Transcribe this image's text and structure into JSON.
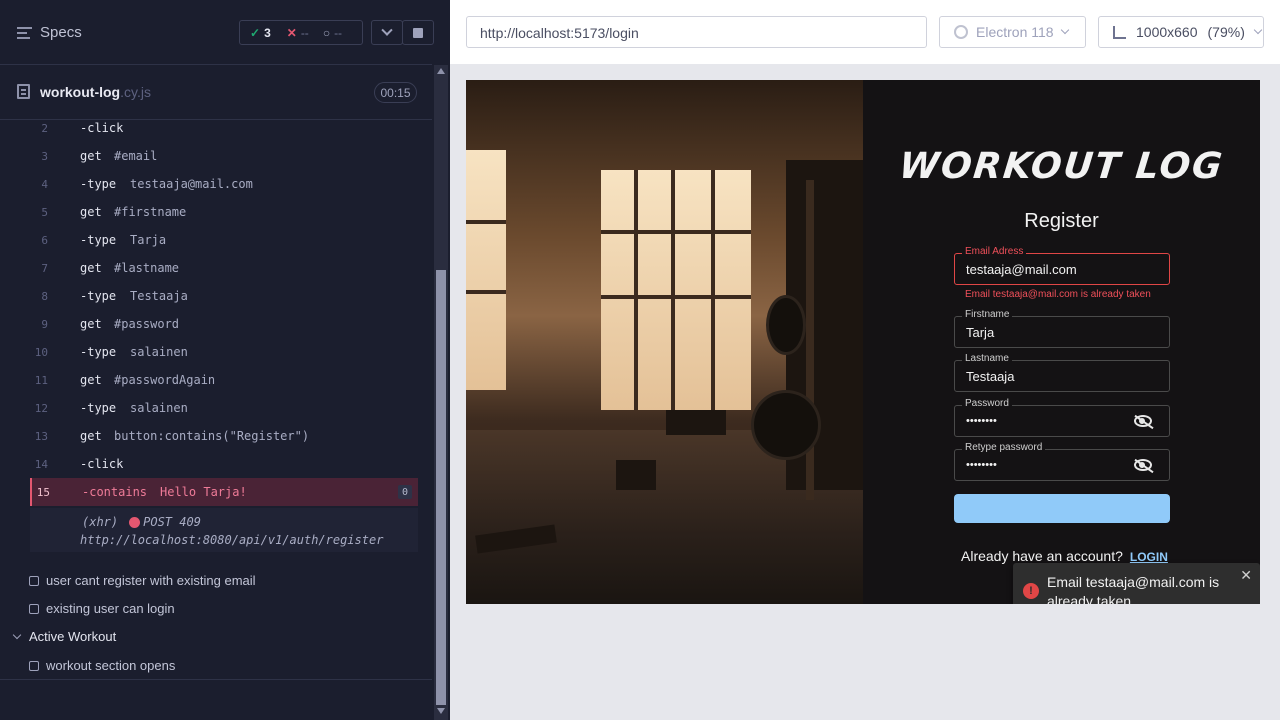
{
  "runner": {
    "specs_label": "Specs",
    "passed": "3",
    "failed": "--",
    "pending": "--",
    "file_name": "workout-log",
    "file_ext": ".cy.js",
    "duration": "00:15"
  },
  "commands": [
    {
      "num": "2",
      "name": "-click",
      "msg": ""
    },
    {
      "num": "3",
      "name": "get",
      "msg": "#email"
    },
    {
      "num": "4",
      "name": "-type",
      "msg": "testaaja@mail.com"
    },
    {
      "num": "5",
      "name": "get",
      "msg": "#firstname"
    },
    {
      "num": "6",
      "name": "-type",
      "msg": "Tarja"
    },
    {
      "num": "7",
      "name": "get",
      "msg": "#lastname"
    },
    {
      "num": "8",
      "name": "-type",
      "msg": "Testaaja"
    },
    {
      "num": "9",
      "name": "get",
      "msg": "#password"
    },
    {
      "num": "10",
      "name": "-type",
      "msg": "salainen"
    },
    {
      "num": "11",
      "name": "get",
      "msg": "#passwordAgain"
    },
    {
      "num": "12",
      "name": "-type",
      "msg": "salainen"
    },
    {
      "num": "13",
      "name": "get",
      "msg": "button:contains(\"Register\")"
    },
    {
      "num": "14",
      "name": "-click",
      "msg": ""
    },
    {
      "num": "15",
      "name": "-contains",
      "msg": "Hello Tarja!",
      "badge": "0"
    }
  ],
  "xhr": {
    "label": "(xhr)",
    "method": "POST 409",
    "url": "http://localhost:8080/api/v1/auth/register"
  },
  "tests": {
    "t1": "user cant register with existing email",
    "t2": "existing user can login",
    "suite": "Active Workout",
    "t3": "workout section opens"
  },
  "browser_bar": {
    "url": "http://localhost:5173/login",
    "browser": "Electron 118",
    "viewport": "1000x660",
    "zoom": "(79%)"
  },
  "app": {
    "logo": "WORKOUT LOG",
    "title": "Register",
    "email_label": "Email Adress",
    "email_value": "testaaja@mail.com",
    "email_error": "Email testaaja@mail.com is already taken",
    "firstname_label": "Firstname",
    "firstname_value": "Tarja",
    "lastname_label": "Lastname",
    "lastname_value": "Testaaja",
    "password_label": "Password",
    "password_value": "••••••••",
    "retype_label": "Retype password",
    "retype_value": "••••••••",
    "already_text": "Already have an account?",
    "login_link": "LOGIN",
    "toast_message": "Email testaaja@mail.com is already taken"
  }
}
